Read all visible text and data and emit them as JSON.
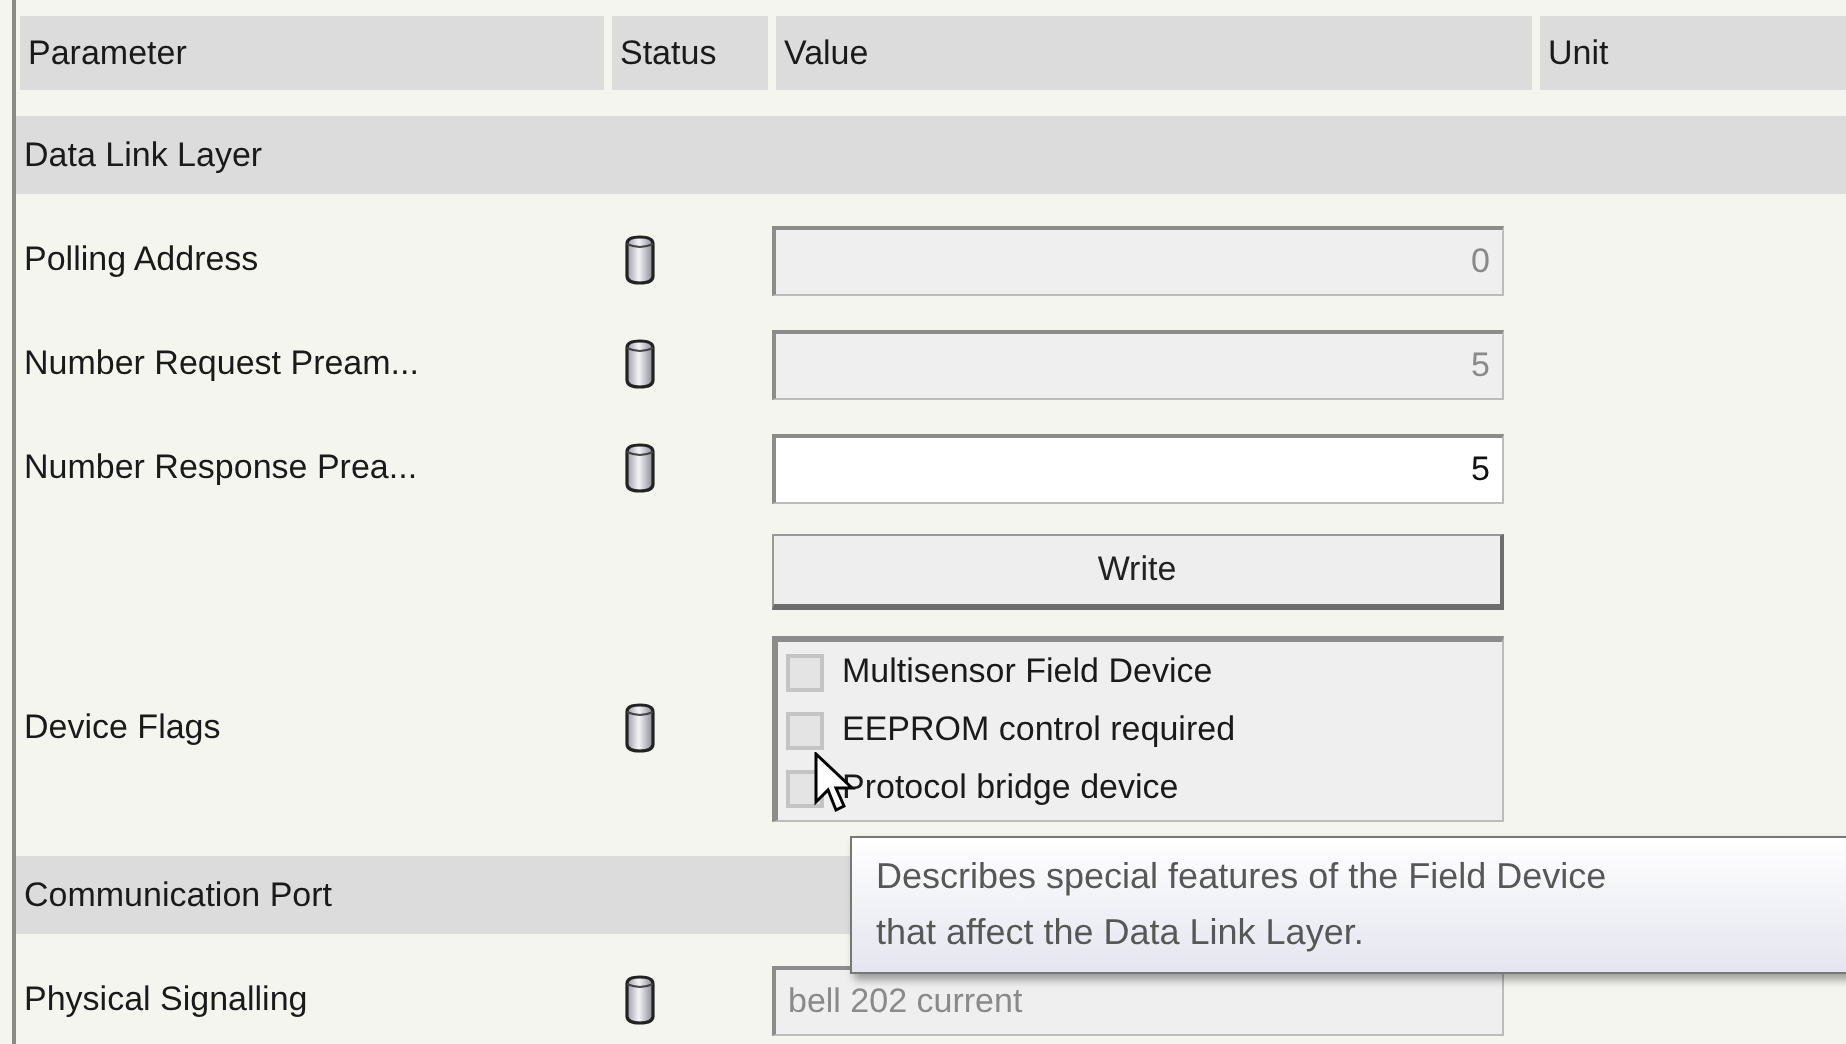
{
  "columns": [
    "Parameter",
    "Status",
    "Value",
    "Unit"
  ],
  "sections": [
    {
      "title": "Data Link Layer",
      "rows": [
        {
          "kind": "number-field",
          "label": "Polling Address",
          "value": "0",
          "disabled": true
        },
        {
          "kind": "number-field",
          "label": "Number Request Pream...",
          "value": "5",
          "disabled": true
        },
        {
          "kind": "number-field",
          "label": "Number Response Prea...",
          "value": "5",
          "disabled": false
        },
        {
          "kind": "button",
          "label_text": "Write"
        },
        {
          "kind": "flags",
          "label": "Device Flags",
          "flags": [
            {
              "label": "Multisensor Field Device",
              "checked": false
            },
            {
              "label": "EEPROM control required",
              "checked": false
            },
            {
              "label": "Protocol bridge device",
              "checked": false
            }
          ]
        }
      ]
    },
    {
      "title": "Communication Port",
      "rows": [
        {
          "kind": "text-field",
          "label": "Physical Signalling",
          "value": "bell 202 current",
          "disabled": true
        }
      ]
    }
  ],
  "tooltip": {
    "lines": [
      "Describes special features of the Field Device",
      "that affect the Data Link Layer."
    ]
  }
}
